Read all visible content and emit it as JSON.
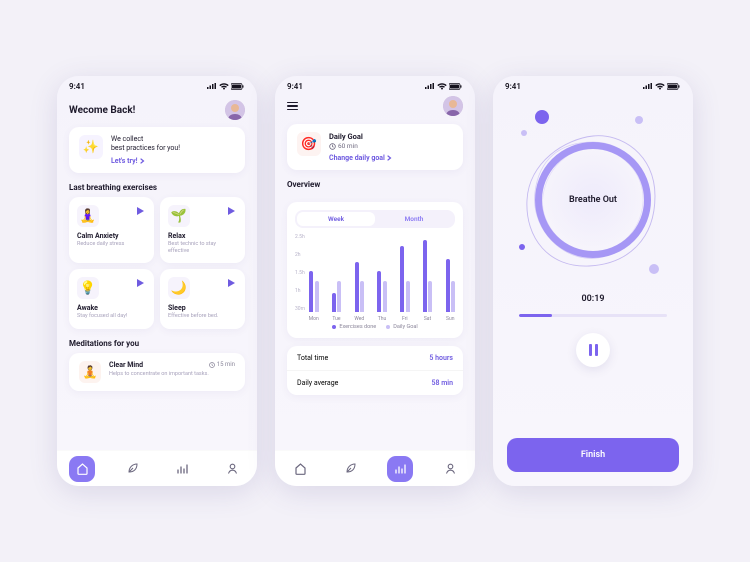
{
  "status": {
    "time": "9:41"
  },
  "colors": {
    "accent": "#7c64ee",
    "accent_light": "#c9bff6"
  },
  "screen1": {
    "welcome": "Wecome Back!",
    "collect": {
      "line1": "We collect",
      "line2": "best practices for you!",
      "cta": "Let's try!"
    },
    "section_breathing": "Last breathing exercises",
    "exercises": [
      {
        "emoji": "🧘‍♀️",
        "title": "Calm Anxiety",
        "sub": "Reduce daily stress"
      },
      {
        "emoji": "🌱",
        "title": "Relax",
        "sub": "Best technic to stay effective"
      },
      {
        "emoji": "💡",
        "title": "Awake",
        "sub": "Stay focused all day!"
      },
      {
        "emoji": "🌙",
        "title": "Sleep",
        "sub": "Effective before bed."
      }
    ],
    "section_meditations": "Meditations for you",
    "meditation": {
      "emoji": "🧘",
      "title": "Clear Mind",
      "duration": "15 min",
      "sub": "Helps to concentrate on important tasks."
    },
    "nav": [
      "home",
      "leaf",
      "stats",
      "user"
    ]
  },
  "screen2": {
    "goal": {
      "title": "Daily Goal",
      "sub": "60 min",
      "cta": "Change daily goal"
    },
    "overview_label": "Overview",
    "seg": {
      "week": "Week",
      "month": "Month"
    },
    "legend": {
      "done": "Exercises done",
      "goal": "Daily Goal"
    },
    "stats": [
      {
        "label": "Total time",
        "value": "5 hours"
      },
      {
        "label": "Daily average",
        "value": "58 min"
      }
    ]
  },
  "chart_data": {
    "type": "bar",
    "categories": [
      "Mon",
      "Tue",
      "Wed",
      "Thu",
      "Fri",
      "Sat",
      "Sun"
    ],
    "series": [
      {
        "name": "Exercises done",
        "values": [
          1.3,
          0.6,
          1.6,
          1.3,
          2.1,
          2.3,
          1.7
        ]
      },
      {
        "name": "Daily Goal",
        "values": [
          1.0,
          1.0,
          1.0,
          1.0,
          1.0,
          1.0,
          1.0
        ]
      }
    ],
    "ylim": [
      0,
      2.5
    ],
    "yticks": [
      "2.5h",
      "2h",
      "1.5h",
      "1h",
      "30m"
    ],
    "ylabel": "",
    "xlabel": "",
    "title": ""
  },
  "screen3": {
    "phase": "Breathe Out",
    "timer": "00:19",
    "progress_pct": 22,
    "finish": "Finish"
  }
}
